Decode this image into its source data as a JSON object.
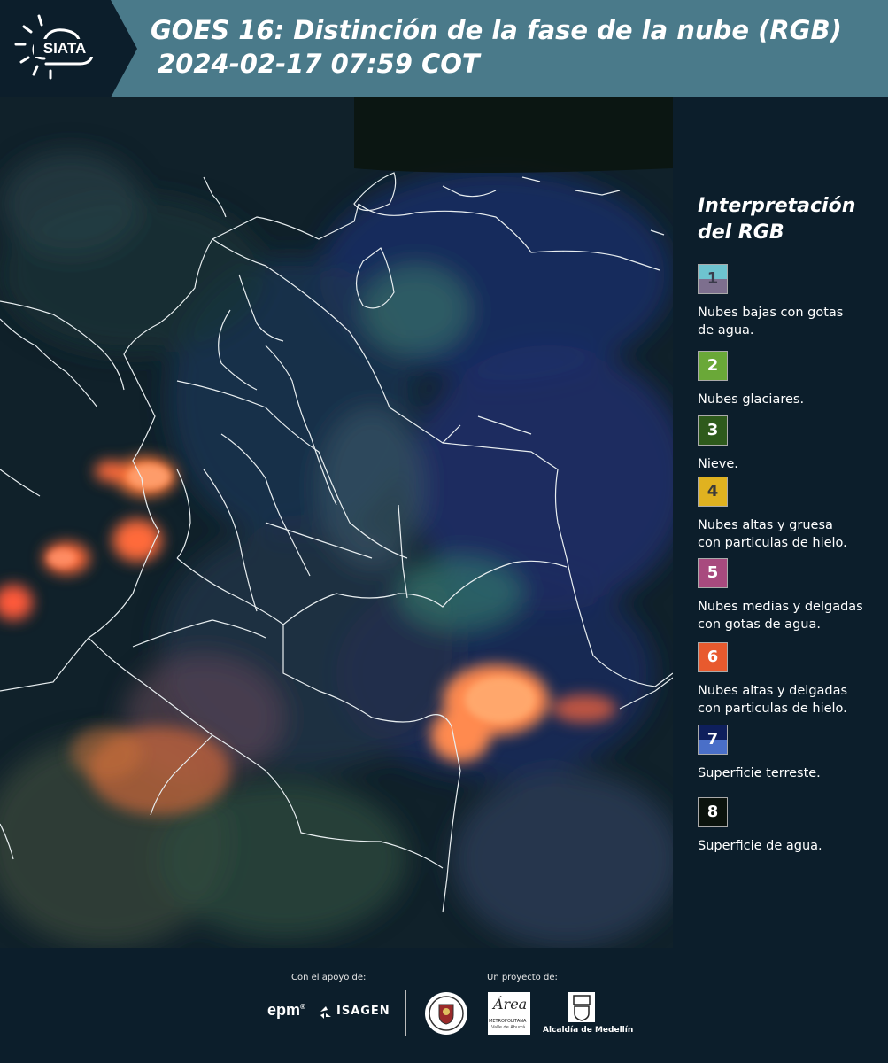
{
  "header": {
    "logo_text": "SIATA",
    "title": "GOES 16: Distinción de la fase de la nube (RGB)",
    "subtitle": "2024-02-17 07:59 COT"
  },
  "legend": {
    "title_line1": "Interpretación",
    "title_line2": "del RGB",
    "items": [
      {
        "num": "1",
        "label_l1": "Nubes bajas con gotas",
        "label_l2": "de agua.",
        "color_top": "#6ec3cf",
        "color_bottom": "#7d6f8e",
        "num_color": "#3a3a4a"
      },
      {
        "num": "2",
        "label_l1": "Nubes glaciares.",
        "label_l2": "",
        "color_top": "#6aa838",
        "color_bottom": "#6aa838",
        "num_color": "#ffffff"
      },
      {
        "num": "3",
        "label_l1": "Nieve.",
        "label_l2": "",
        "color_top": "#2e5a1c",
        "color_bottom": "#2e5a1c",
        "num_color": "#ffffff"
      },
      {
        "num": "4",
        "label_l1": "Nubes altas y gruesa",
        "label_l2": "con particulas de hielo.",
        "color_top": "#e0b220",
        "color_bottom": "#e0b220",
        "num_color": "#3a3a3a"
      },
      {
        "num": "5",
        "label_l1": "Nubes medias y delgadas",
        "label_l2": "con gotas de agua.",
        "color_top": "#a84a7e",
        "color_bottom": "#a84a7e",
        "num_color": "#ffffff"
      },
      {
        "num": "6",
        "label_l1": "Nubes altas y delgadas",
        "label_l2": "con particulas de hielo.",
        "color_top": "#e85a2e",
        "color_bottom": "#e85a2e",
        "num_color": "#ffffff"
      },
      {
        "num": "7",
        "label_l1": "Superficie terreste.",
        "label_l2": "",
        "color_top": "#0e1f5c",
        "color_bottom": "#4a6fc8",
        "num_color": "#ffffff"
      },
      {
        "num": "8",
        "label_l1": "Superficie de agua.",
        "label_l2": "",
        "color_top": "#0b130d",
        "color_bottom": "#0b130d",
        "num_color": "#ffffff"
      }
    ]
  },
  "footer": {
    "support_label": "Con el apoyo de:",
    "project_label": "Un proyecto de:",
    "epm": "epm",
    "isagen": "ISAGEN",
    "metro_big": "Área",
    "metro_line1": "METROPOLITANA",
    "metro_line2": "Valle de Aburrá",
    "alcaldia": "Alcaldía de Medellín"
  }
}
